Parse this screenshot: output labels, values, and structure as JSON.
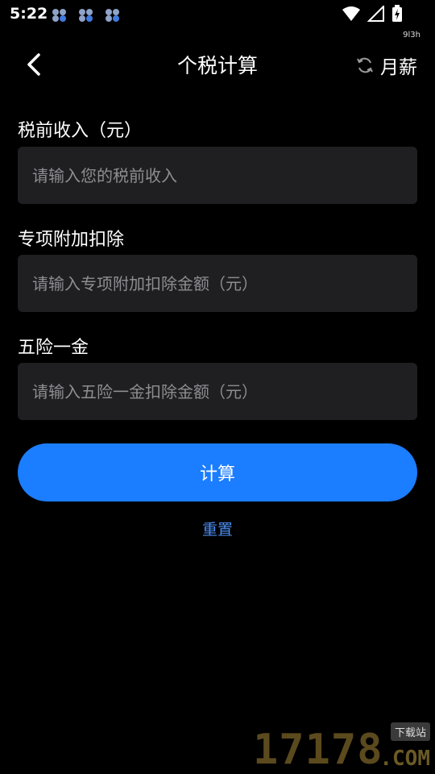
{
  "status_bar": {
    "time": "5:22",
    "notification_icons": [
      "app-notification-icon",
      "app-notification-icon",
      "app-notification-icon"
    ],
    "sub_status": "9l3h"
  },
  "nav": {
    "title": "个税计算",
    "mode_label": "月薪"
  },
  "form": {
    "income_label": "税前收入（元）",
    "income_placeholder": "请输入您的税前收入",
    "deduction_label": "专项附加扣除",
    "deduction_placeholder": "请输入专项附加扣除金额（元）",
    "insurance_label": "五险一金",
    "insurance_placeholder": "请输入五险一金扣除金额（元）"
  },
  "actions": {
    "calculate_label": "计算",
    "reset_label": "重置"
  },
  "watermark": {
    "digits": "17178",
    "domain": ".COM",
    "badge": "下载站"
  },
  "colors": {
    "background": "#000000",
    "field_bg": "#1f1f22",
    "primary_button": "#1b7dff",
    "link": "#4c8ef2",
    "placeholder": "#8d8d92"
  }
}
